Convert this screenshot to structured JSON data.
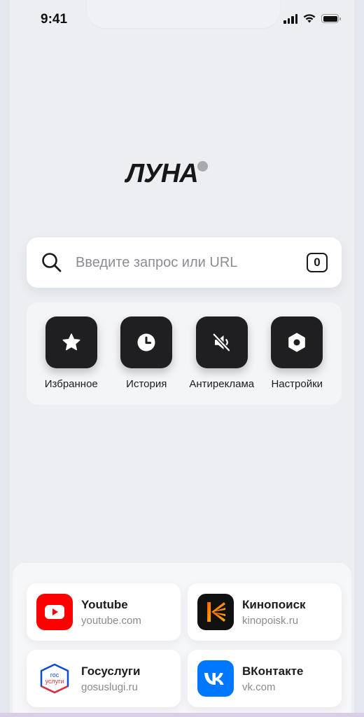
{
  "status_bar": {
    "time": "9:41"
  },
  "logo": {
    "text": "ЛУНА"
  },
  "search": {
    "placeholder": "Введите запрос или URL",
    "tabs_count": "0"
  },
  "quick_actions": [
    {
      "label": "Избранное",
      "icon": "star-icon"
    },
    {
      "label": "История",
      "icon": "clock-icon"
    },
    {
      "label": "Антиреклама",
      "icon": "muted-speaker-icon"
    },
    {
      "label": "Настройки",
      "icon": "hexagon-nut-icon"
    }
  ],
  "sites": [
    {
      "name": "Youtube",
      "url": "youtube.com",
      "color": "#ff0000"
    },
    {
      "name": "Кинопоиск",
      "url": "kinopoisk.ru",
      "color": "#ff5500"
    },
    {
      "name": "Госуслуги",
      "url": "gosuslugi.ru",
      "logo_text_top": "гос",
      "logo_text_bottom": "услуги",
      "color": "#0d4cd3"
    },
    {
      "name": "ВКонтакте",
      "url": "vk.com",
      "color": "#0077ff"
    }
  ],
  "colors": {
    "background": "#eceef2",
    "tile": "#1f1f21",
    "accent_youtube": "#ff0000",
    "accent_vk": "#0077ff"
  }
}
